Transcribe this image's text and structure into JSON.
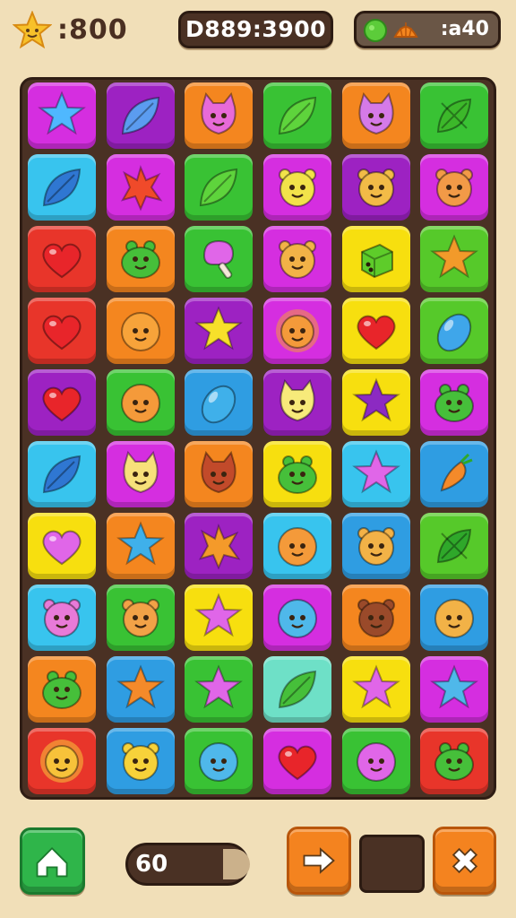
{
  "hud": {
    "left_score": ":800",
    "center_score": "D889:3900",
    "right_counter": ":a40",
    "left_icon": "star-icon",
    "right_icons": [
      "green-gem-icon",
      "orange-shell-icon"
    ]
  },
  "colors": {
    "red": "#e8352a",
    "orange": "#f4861f",
    "yellow": "#f7df0f",
    "green": "#39c234",
    "lime": "#56c92a",
    "blue": "#2f9de2",
    "cyan": "#38c4ee",
    "teal": "#6ee0c7",
    "magenta": "#d52ee0",
    "purple": "#9d22c2",
    "board": "#4a3124",
    "background": "#f1dfb8"
  },
  "board": {
    "rows": 9,
    "cols": 6,
    "tiles": [
      [
        {
          "bg": "magenta",
          "icon": "star",
          "fill": "#4fb8ff"
        },
        {
          "bg": "purple",
          "icon": "leaf",
          "fill": "#5b9cf0"
        },
        {
          "bg": "orange",
          "icon": "cat",
          "fill": "#e86ad8"
        },
        {
          "bg": "green",
          "icon": "leaf",
          "fill": "#5ed43c"
        },
        {
          "bg": "orange",
          "icon": "cat",
          "fill": "#d57ae8"
        },
        {
          "bg": "green",
          "icon": "xleaf",
          "fill": "#3cb82a"
        }
      ],
      [
        {
          "bg": "cyan",
          "icon": "leaf",
          "fill": "#2f77d2"
        },
        {
          "bg": "magenta",
          "icon": "xstar",
          "fill": "#f04a2a"
        },
        {
          "bg": "green",
          "icon": "leaf",
          "fill": "#5ed43c"
        },
        {
          "bg": "magenta",
          "icon": "bear",
          "fill": "#f2e24a"
        },
        {
          "bg": "purple",
          "icon": "bear",
          "fill": "#f2bb47"
        },
        {
          "bg": "magenta",
          "icon": "bear",
          "fill": "#f29a47"
        }
      ],
      [
        {
          "bg": "red",
          "icon": "heart",
          "fill": "#e8252a"
        },
        {
          "bg": "orange",
          "icon": "frog",
          "fill": "#46bf3a"
        },
        {
          "bg": "green",
          "icon": "lolly",
          "fill": "#e066e8"
        },
        {
          "bg": "magenta",
          "icon": "bear",
          "fill": "#f2b247"
        },
        {
          "bg": "yellow",
          "icon": "dice",
          "fill": "#5ecc2a"
        },
        {
          "bg": "lime",
          "icon": "star",
          "fill": "#f29a2a"
        }
      ],
      [
        {
          "bg": "red",
          "icon": "heart",
          "fill": "#e8252a"
        },
        {
          "bg": "orange",
          "icon": "face",
          "fill": "#f7a33a"
        },
        {
          "bg": "purple",
          "icon": "star",
          "fill": "#f7e02a"
        },
        {
          "bg": "magenta",
          "icon": "sun",
          "fill": "#f49a3a"
        },
        {
          "bg": "yellow",
          "icon": "heart",
          "fill": "#e8252a"
        },
        {
          "bg": "lime",
          "icon": "gem",
          "fill": "#3fa6ea"
        }
      ],
      [
        {
          "bg": "purple",
          "icon": "heart",
          "fill": "#e8252a"
        },
        {
          "bg": "green",
          "icon": "face",
          "fill": "#f49a3a"
        },
        {
          "bg": "blue",
          "icon": "gem",
          "fill": "#3fb0ea"
        },
        {
          "bg": "purple",
          "icon": "cat",
          "fill": "#f7ea7a"
        },
        {
          "bg": "yellow",
          "icon": "star",
          "fill": "#8c2ac2"
        },
        {
          "bg": "magenta",
          "icon": "frog",
          "fill": "#46bf3a"
        }
      ],
      [
        {
          "bg": "cyan",
          "icon": "leaf",
          "fill": "#2f77d2"
        },
        {
          "bg": "magenta",
          "icon": "cat",
          "fill": "#f7e07a"
        },
        {
          "bg": "orange",
          "icon": "cat",
          "fill": "#c24a2a"
        },
        {
          "bg": "yellow",
          "icon": "frog",
          "fill": "#46bf3a"
        },
        {
          "bg": "cyan",
          "icon": "star",
          "fill": "#e066e8"
        },
        {
          "bg": "blue",
          "icon": "carrot",
          "fill": "#f48a2a"
        }
      ],
      [
        {
          "bg": "yellow",
          "icon": "heart",
          "fill": "#e066e8"
        },
        {
          "bg": "orange",
          "icon": "star",
          "fill": "#3fb0ea"
        },
        {
          "bg": "purple",
          "icon": "xstar",
          "fill": "#f49a2a"
        },
        {
          "bg": "cyan",
          "icon": "face",
          "fill": "#f49a3a"
        },
        {
          "bg": "blue",
          "icon": "bear",
          "fill": "#f2b247"
        },
        {
          "bg": "lime",
          "icon": "xleaf",
          "fill": "#2fa82a"
        }
      ],
      [
        {
          "bg": "cyan",
          "icon": "bear",
          "fill": "#e87ad8"
        },
        {
          "bg": "green",
          "icon": "bear",
          "fill": "#f2a247"
        },
        {
          "bg": "yellow",
          "icon": "star",
          "fill": "#e066e8"
        },
        {
          "bg": "magenta",
          "icon": "face",
          "fill": "#4fb8ea"
        },
        {
          "bg": "orange",
          "icon": "bear",
          "fill": "#9a4a2a"
        },
        {
          "bg": "blue",
          "icon": "face",
          "fill": "#f2b247"
        }
      ],
      [
        {
          "bg": "orange",
          "icon": "frog",
          "fill": "#46bf3a"
        },
        {
          "bg": "blue",
          "icon": "star",
          "fill": "#f48a2a"
        },
        {
          "bg": "green",
          "icon": "star",
          "fill": "#e066e8"
        },
        {
          "bg": "teal",
          "icon": "leaf",
          "fill": "#46bf3a"
        },
        {
          "bg": "yellow",
          "icon": "star",
          "fill": "#e066e8"
        },
        {
          "bg": "magenta",
          "icon": "star",
          "fill": "#4fb8ea"
        }
      ],
      [
        {
          "bg": "red",
          "icon": "sun",
          "fill": "#f7c23a"
        },
        {
          "bg": "blue",
          "icon": "bear",
          "fill": "#f7d23a"
        },
        {
          "bg": "green",
          "icon": "face",
          "fill": "#4fb8ea"
        },
        {
          "bg": "magenta",
          "icon": "heart",
          "fill": "#e8252a"
        },
        {
          "bg": "green",
          "icon": "face",
          "fill": "#e066e8"
        },
        {
          "bg": "red",
          "icon": "frog",
          "fill": "#46bf3a"
        }
      ]
    ]
  },
  "bottom_bar": {
    "moves_value": "60",
    "home_icon": "home-icon",
    "next_icon": "arrow-right-icon",
    "close_icon": "close-icon"
  }
}
